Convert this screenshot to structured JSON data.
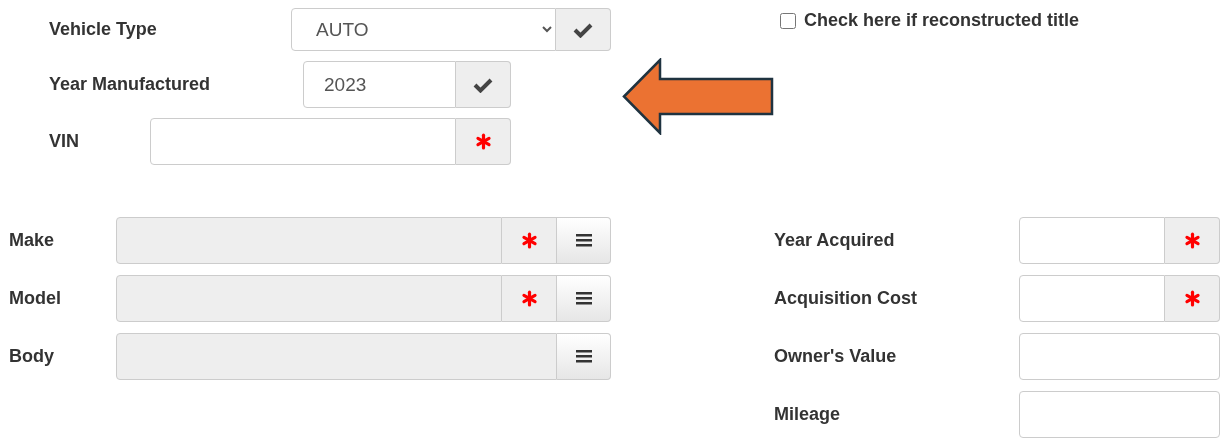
{
  "top_fields": [
    {
      "label": "Vehicle Type",
      "kind": "select",
      "value": "AUTO",
      "validated": true,
      "required": false
    },
    {
      "label": "Year Manufactured",
      "kind": "text",
      "value": "2023",
      "validated": true,
      "required": false
    },
    {
      "label": "VIN",
      "kind": "text",
      "validated": false,
      "required": true
    }
  ],
  "reconstructed_title": {
    "label": "Check here if reconstructed title",
    "checked": false
  },
  "vehicle_fields": [
    {
      "label": "Make",
      "required": true
    },
    {
      "label": "Model",
      "required": true
    },
    {
      "label": "Body",
      "required": false
    }
  ],
  "cost_fields": [
    {
      "label": "Year Acquired",
      "required": true
    },
    {
      "label": "Acquisition Cost",
      "required": true
    },
    {
      "label": "Owner's Value",
      "required": false
    },
    {
      "label": "Mileage",
      "required": false
    }
  ]
}
